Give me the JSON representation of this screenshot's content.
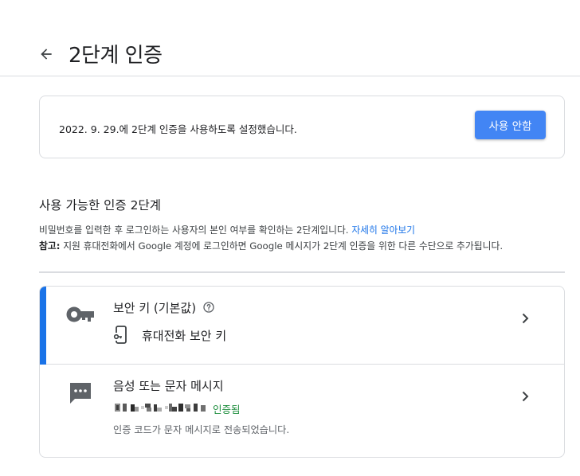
{
  "header": {
    "title": "2단계 인증",
    "back_icon": "arrow-back-icon"
  },
  "status": {
    "text": "2022. 9. 29.에 2단계 인증을 사용하도록 설정했습니다.",
    "disable_button_label": "사용 안함"
  },
  "section": {
    "title": "사용 가능한 인증 2단계",
    "description": "비밀번호를 입력한 후 로그인하는 사용자의 본인 여부를 확인하는 2단계입니다.",
    "learn_more_link": "자세히 알아보기",
    "note_label": "참고:",
    "note_text": "지원 휴대전화에서 Google 계정에 로그인하면 Google 메시지가 2단계 인증을 위한 다른 수단으로 추가됩니다."
  },
  "methods": [
    {
      "title": "보안 키 (기본값)",
      "icon": "key-icon",
      "help_icon": "help-circle-icon",
      "sub_icon": "phone-key-icon",
      "sub_label": "휴대전화 보안 키"
    },
    {
      "title": "음성 또는 문자 메시지",
      "icon": "sms-icon",
      "verified_label": "인증됨",
      "description": "인증 코드가 문자 메시지로 전송되었습니다."
    }
  ],
  "colors": {
    "accent": "#1a73e8",
    "button": "#4285f4",
    "verified": "#1e8e3e",
    "border": "#dadce0"
  }
}
